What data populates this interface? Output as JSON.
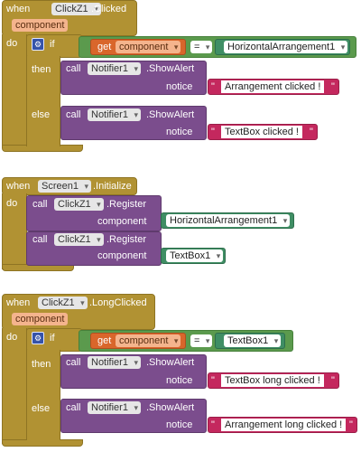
{
  "kw": {
    "when": "when",
    "do": "do",
    "if": "if",
    "then": "then",
    "else": "else",
    "call": "call",
    "get": "get",
    "component": "component",
    "notice": "notice",
    "eq": "=",
    "q": "\""
  },
  "block1": {
    "comp": "ClickZ1",
    "event": ".Clicked",
    "param": "component",
    "getvar": "component",
    "compare": "HorizontalArrangement1",
    "then_comp": "Notifier1",
    "then_method": ".ShowAlert",
    "then_text": "Arrangement clicked !",
    "else_comp": "Notifier1",
    "else_method": ".ShowAlert",
    "else_text": "TextBox clicked !"
  },
  "block2": {
    "comp": "Screen1",
    "event": ".Initialize",
    "call1_comp": "ClickZ1",
    "call1_method": ".Register",
    "call1_arg": "HorizontalArrangement1",
    "call2_comp": "ClickZ1",
    "call2_method": ".Register",
    "call2_arg": "TextBox1"
  },
  "block3": {
    "comp": "ClickZ1",
    "event": ".LongClicked",
    "param": "component",
    "getvar": "component",
    "compare": "TextBox1",
    "then_comp": "Notifier1",
    "then_method": ".ShowAlert",
    "then_text": "TextBox long clicked !",
    "else_comp": "Notifier1",
    "else_method": ".ShowAlert",
    "else_text": "Arrangement long clicked !"
  },
  "icons": {
    "mutator": "gear-icon",
    "dropdown": "chevron-down-icon"
  }
}
